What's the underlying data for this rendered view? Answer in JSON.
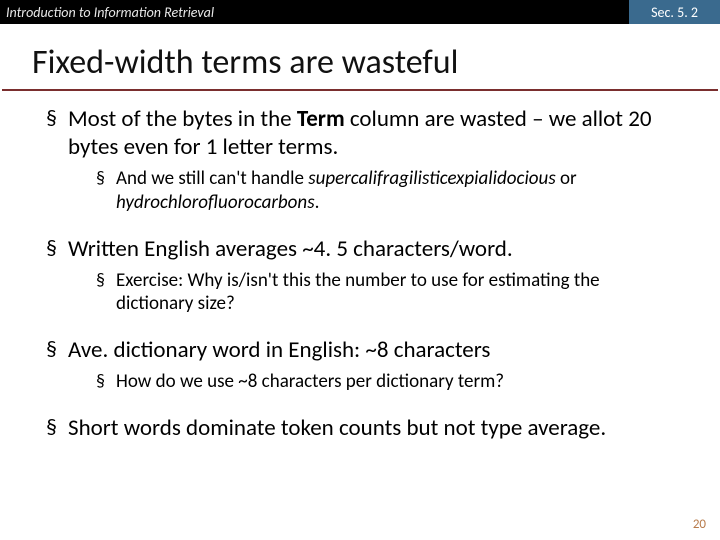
{
  "header": {
    "left": "Introduction to Information Retrieval",
    "right": "Sec. 5. 2"
  },
  "title": "Fixed-width terms are wasteful",
  "bullets": {
    "b0_pre": "Most of the bytes in the ",
    "b0_bold": "Term",
    "b0_post": " column are wasted – we allot 20 bytes even for 1 letter terms.",
    "b0_0_pre": "And we still can't handle ",
    "b0_0_it1": "supercalifragilisticexpialidocious",
    "b0_0_mid": " or ",
    "b0_0_it2": "hydrochlorofluorocarbons",
    "b0_0_post": ".",
    "b1": "Written English averages ~4. 5 characters/word.",
    "b1_0": "Exercise: Why is/isn't this the number to use for estimating the dictionary size?",
    "b2": "Ave. dictionary word in English: ~8 characters",
    "b2_0": "How do we use ~8 characters per dictionary term?",
    "b3": "Short words dominate token counts but not type average."
  },
  "page_number": "20"
}
